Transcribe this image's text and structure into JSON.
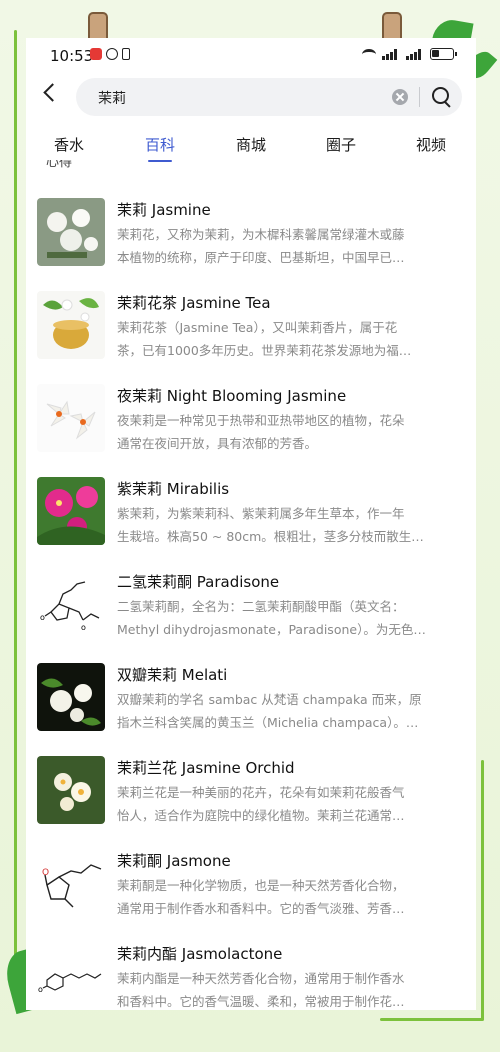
{
  "status_bar": {
    "time": "10:53"
  },
  "search": {
    "query": "茉莉"
  },
  "tabs": [
    {
      "label": "香水"
    },
    {
      "label": "百科"
    },
    {
      "label": "商城"
    },
    {
      "label": "圈子"
    },
    {
      "label": "视频"
    }
  ],
  "active_tab": "百科",
  "partial_heading": "心得",
  "results": [
    {
      "title": "茉莉 Jasmine",
      "line1": "茉莉花，又称为茉莉，为木樨科素馨属常绿灌木或藤",
      "line2": "本植物的统称，原产于印度、巴基斯坦，中国早已…",
      "icon": "jasmine-flower-photo"
    },
    {
      "title": "茉莉花茶 Jasmine Tea",
      "line1": "茉莉花茶（Jasmine Tea），又叫茉莉香片，属于花",
      "line2": "茶，已有1000多年历史。世界茉莉花茶发源地为福…",
      "icon": "jasmine-tea-photo"
    },
    {
      "title": "夜茉莉 Night Blooming Jasmine",
      "line1": "夜茉莉是一种常见于热带和亚热带地区的植物，花朵",
      "line2": "通常在夜间开放，具有浓郁的芳香。",
      "icon": "night-jasmine-photo"
    },
    {
      "title": "紫茉莉 Mirabilis",
      "line1": "紫茉莉，为紫茉莉科、紫茉莉属多年生草本，作一年",
      "line2": "生栽培。株高50 ~ 80cm。根粗壮，茎多分枝而散生…",
      "icon": "mirabilis-photo"
    },
    {
      "title": "二氢茉莉酮 Paradisone",
      "line1": "二氢茉莉酮，全名为：二氢茉莉酮酸甲酯（英文名：",
      "line2": "Methyl dihydrojasmonate，Paradisone）。为无色…",
      "icon": "paradisone-structure"
    },
    {
      "title": "双瓣茉莉 Melati",
      "line1": "双瓣茉莉的学名 sambac 从梵语 champaka 而来，原",
      "line2": "指木兰科含笑属的黄玉兰（Michelia champaca）。…",
      "icon": "melati-photo"
    },
    {
      "title": "茉莉兰花 Jasmine Orchid",
      "line1": "茉莉兰花是一种美丽的花卉，花朵有如茉莉花般香气",
      "line2": "怡人，适合作为庭院中的绿化植物。茉莉兰花通常…",
      "icon": "jasmine-orchid-photo"
    },
    {
      "title": "茉莉酮 Jasmone",
      "line1": "茉莉酮是一种化学物质，也是一种天然芳香化合物，",
      "line2": "通常用于制作香水和香料中。它的香气淡雅、芳香…",
      "icon": "jasmone-structure"
    },
    {
      "title": "茉莉内酯 Jasmolactone",
      "line1": "茉莉内酯是一种天然芳香化合物，通常用于制作香水",
      "line2": "和香料中。它的香气温暖、柔和，常被用于制作花…",
      "icon": "jasmolactone-structure"
    }
  ],
  "colors": {
    "accent": "#3f5bd0",
    "frame_green": "#7cc13c"
  }
}
